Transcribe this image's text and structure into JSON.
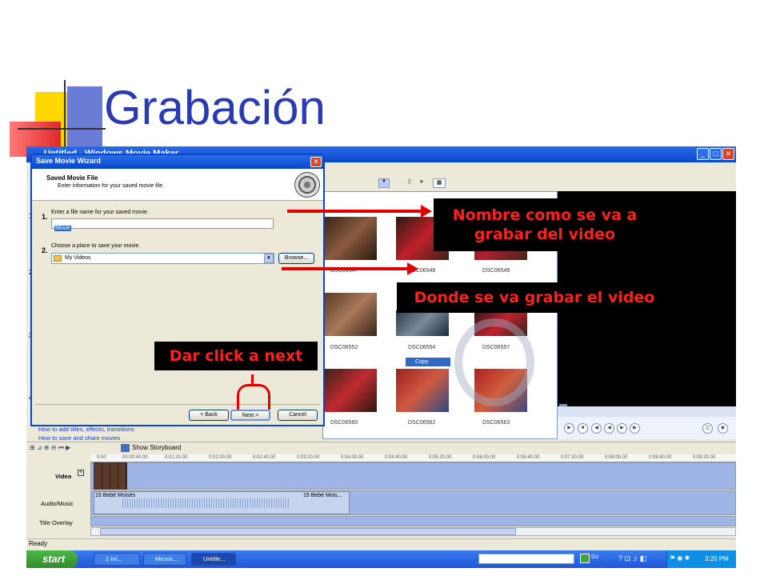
{
  "slide": {
    "title": "Grabación"
  },
  "app": {
    "title": "Untitled - Windows Movie Maker",
    "tasks_links": [
      "How to add titles, effects, transitions",
      "How to save and share movies"
    ],
    "side_numbers": [
      "1",
      "2",
      "3",
      "4"
    ]
  },
  "dialog": {
    "title": "Save Movie Wizard",
    "heading": "Saved Movie File",
    "subheading": "Enter information for your saved movie file.",
    "step1_num": "1.",
    "step1_label": "Enter a file name for your saved movie.",
    "filename_value": "Movie",
    "step2_num": "2.",
    "step2_label": "Choose a place to save your movie.",
    "location_value": "My Videos",
    "browse_label": "Browse...",
    "back_label": "< Back",
    "next_label": "Next >",
    "cancel_label": "Cancel"
  },
  "thumbnails": [
    {
      "label": "DSC06547"
    },
    {
      "label": "DSC06548"
    },
    {
      "label": "DSC06549"
    },
    {
      "label": "DSC06552"
    },
    {
      "label": "DSC06554"
    },
    {
      "label": "DSC06557"
    },
    {
      "label": "DSC06560"
    },
    {
      "label": "DSC06562"
    },
    {
      "label": "DSC06563"
    }
  ],
  "context_menu": {
    "copy_label": "Copy"
  },
  "timeline": {
    "storyboard_label": "Show Storyboard",
    "ruler": [
      "0.00",
      "00:00:40.00",
      "0:01:20.00",
      "0:02:00.00",
      "0:02:40.00",
      "0:03:20.00",
      "0:04:00.00",
      "0:04:40.00",
      "0:05:20.00",
      "0:06:00.00",
      "0:06:40.00",
      "0:07:20.00",
      "0:08:00.00",
      "0:08:40.00",
      "0:09:20.00"
    ],
    "tracks": {
      "video": "Video",
      "audio": "Audio/Music",
      "title_overlay": "Title Overlay"
    },
    "audio_clip_label": "15 Bebé Moisés",
    "audio_clip_label2": "15 Bebé Mois..."
  },
  "status": {
    "text": "Ready"
  },
  "taskbar": {
    "start": "start",
    "items": [
      "2 Int...",
      "Micros...",
      "Untitle..."
    ],
    "go_label": "Go",
    "clock": "3:20 PM"
  },
  "annotations": {
    "filename_callout": "Nombre como se va a grabar del video",
    "location_callout": "Donde se va grabar el video",
    "next_callout": "Dar click a next"
  },
  "colors": {
    "accent_red": "#e00000",
    "title_blue": "#2a3ab0",
    "xp_blue": "#0a46c8"
  }
}
